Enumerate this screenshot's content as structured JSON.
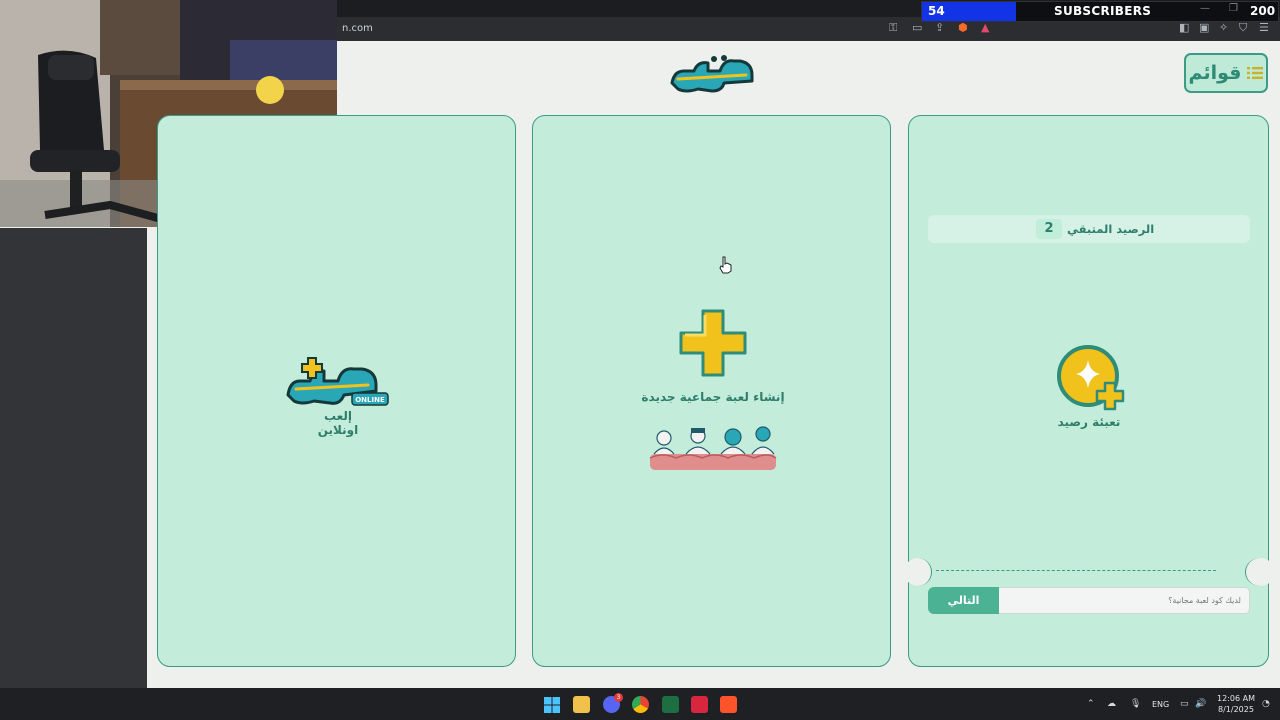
{
  "browser": {
    "url": "n.com"
  },
  "overlay": {
    "subscribers_current": "54",
    "subscribers_label": "SUBSCRIBERS",
    "subscribers_goal": "200",
    "progress_fraction": 0.27
  },
  "header": {
    "menu_label": "قوائم"
  },
  "online_card": {
    "badge": "ONLINE",
    "label": "إلعب اونلاين"
  },
  "create_card": {
    "label": "إنشاء لعبة جماعية جديدة"
  },
  "credit_card": {
    "balance_label": "الرصيد المتبقي",
    "balance_value": "2",
    "recharge_label": "تعبئة رصيد",
    "code_placeholder": "لديك كود لعبة مجانية؟",
    "next_label": "التالي"
  },
  "taskbar": {
    "language": "ENG",
    "time": "12:06 AM",
    "date": "8/1/2025",
    "discord_badge": "3"
  },
  "colors": {
    "accent": "#3b9b86",
    "card_bg": "#c4ecdb",
    "button": "#4bb293",
    "yellow": "#f1c21b"
  }
}
